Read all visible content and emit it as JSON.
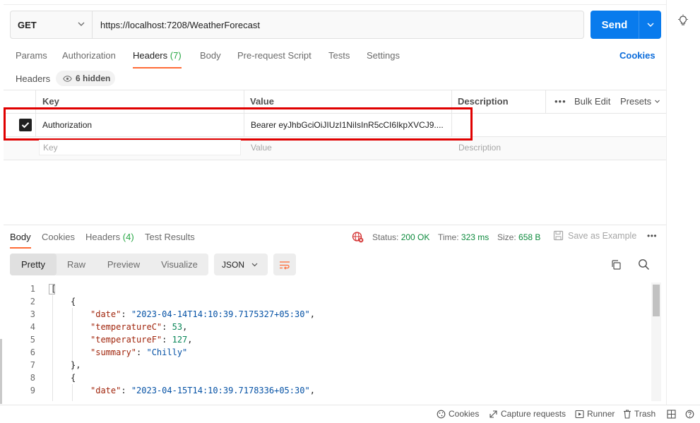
{
  "request": {
    "method": "GET",
    "url": "https://localhost:7208/WeatherForecast",
    "send_label": "Send"
  },
  "request_tabs": [
    {
      "label": "Params",
      "count": ""
    },
    {
      "label": "Authorization",
      "count": ""
    },
    {
      "label": "Headers",
      "count": "(7)"
    },
    {
      "label": "Body",
      "count": ""
    },
    {
      "label": "Pre-request Script",
      "count": ""
    },
    {
      "label": "Tests",
      "count": ""
    },
    {
      "label": "Settings",
      "count": ""
    }
  ],
  "cookies_label": "Cookies",
  "headers_section": {
    "label": "Headers",
    "hidden_count": "6 hidden"
  },
  "headers_table": {
    "columns": [
      "Key",
      "Value",
      "Description"
    ],
    "bulk_edit": "Bulk Edit",
    "presets": "Presets",
    "rows": [
      {
        "key": "Authorization",
        "value": "Bearer eyJhbGciOiJIUzI1NiIsInR5cCI6IkpXVCJ9....",
        "description": "",
        "checked": true
      }
    ],
    "placeholder": {
      "key": "Key",
      "value": "Value",
      "description": "Description"
    }
  },
  "response_tabs": [
    {
      "label": "Body",
      "count": ""
    },
    {
      "label": "Cookies",
      "count": ""
    },
    {
      "label": "Headers",
      "count": "(4)"
    },
    {
      "label": "Test Results",
      "count": ""
    }
  ],
  "response_status": {
    "status_label": "Status:",
    "status_value": "200 OK",
    "time_label": "Time:",
    "time_value": "323 ms",
    "size_label": "Size:",
    "size_value": "658 B",
    "save_example": "Save as Example"
  },
  "view_modes": [
    "Pretty",
    "Raw",
    "Preview",
    "Visualize"
  ],
  "format": "JSON",
  "code_lines": [
    {
      "n": "1",
      "t": "["
    },
    {
      "n": "2",
      "t": "{"
    },
    {
      "n": "3",
      "k": "\"date\"",
      "v": "\"2023-04-14T14:10:39.7175327+05:30\"",
      "vt": "s"
    },
    {
      "n": "4",
      "k": "\"temperatureC\"",
      "v": "53",
      "vt": "n"
    },
    {
      "n": "5",
      "k": "\"temperatureF\"",
      "v": "127",
      "vt": "n"
    },
    {
      "n": "6",
      "k": "\"summary\"",
      "v": "\"Chilly\"",
      "vt": "s",
      "last": true
    },
    {
      "n": "7",
      "t": "},"
    },
    {
      "n": "8",
      "t": "{"
    },
    {
      "n": "9",
      "k": "\"date\"",
      "v": "\"2023-04-15T14:10:39.7178336+05:30\"",
      "vt": "s"
    }
  ],
  "footer": {
    "cookies": "Cookies",
    "capture": "Capture requests",
    "runner": "Runner",
    "trash": "Trash"
  },
  "colors": {
    "accent": "#097bed",
    "active_tab": "#ff6c37",
    "status_ok": "#0c8a3c",
    "highlight": "#e00000"
  }
}
